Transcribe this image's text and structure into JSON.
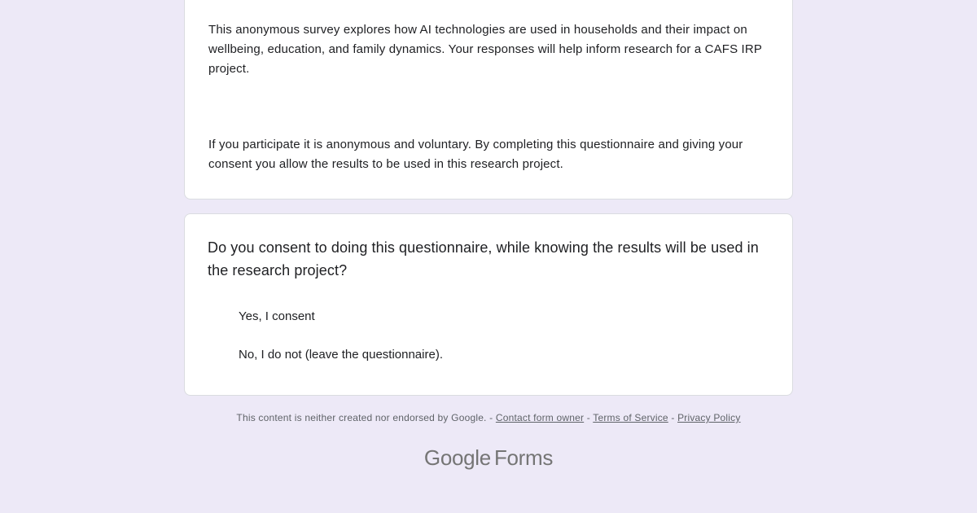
{
  "description": {
    "paragraph1": "This anonymous survey explores how AI technologies are used in households and their impact on wellbeing, education, and family dynamics. Your responses will help inform research for a CAFS IRP project.",
    "paragraph2": "If you participate it is anonymous and voluntary. By completing this questionnaire and giving your consent you allow the results to be used in this research project."
  },
  "question": {
    "title": "Do you consent to doing this questionnaire, while knowing the results will be used in the research project?",
    "options": [
      {
        "label": "Yes, I consent"
      },
      {
        "label": "No, I do not (leave the questionnaire)."
      }
    ]
  },
  "footer": {
    "disclaimer": "This content is neither created nor endorsed by Google.",
    "sep1": " - ",
    "contact": "Contact form owner",
    "sep2": " - ",
    "terms": "Terms of Service",
    "sep3": " - ",
    "privacy": "Privacy Policy"
  },
  "brand": {
    "google": "Google",
    "forms": "Forms"
  }
}
